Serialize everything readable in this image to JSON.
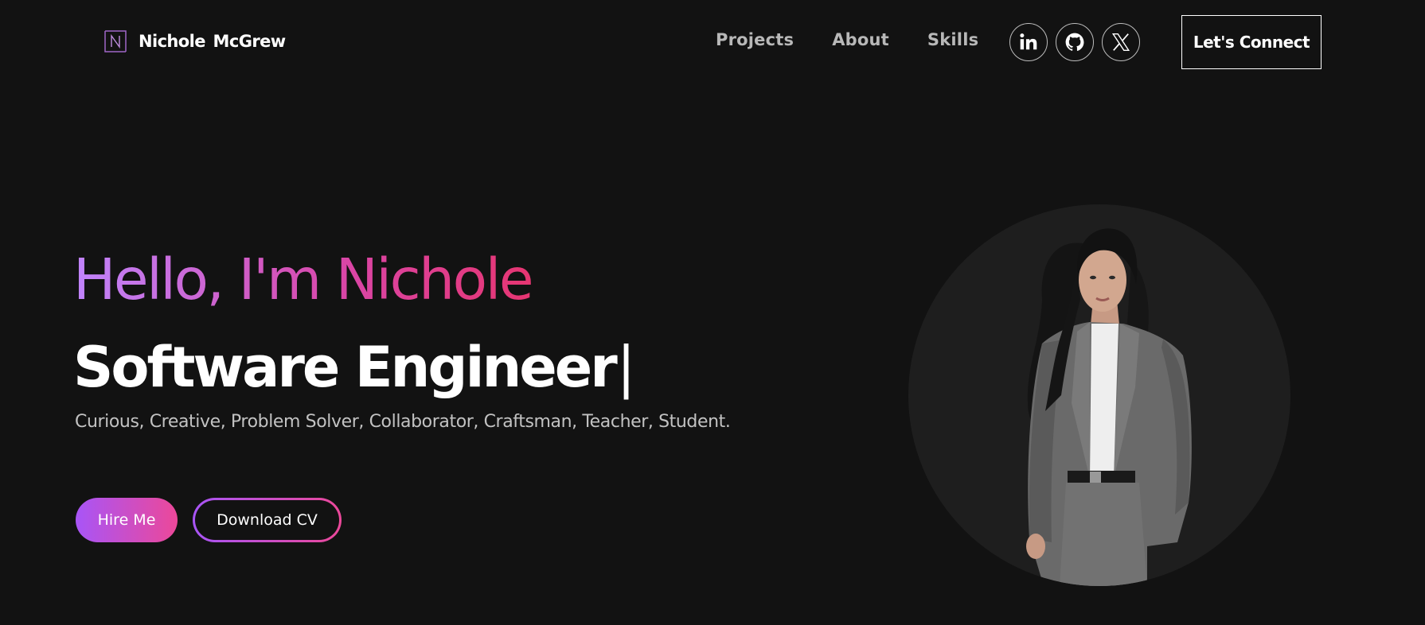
{
  "brand": {
    "logo_icon": "n-monogram-icon",
    "name": "Nichole  McGrew"
  },
  "nav": {
    "links": [
      "Projects",
      "About",
      "Skills"
    ]
  },
  "socials": {
    "icons": [
      "linkedin-icon",
      "github-icon",
      "x-icon"
    ]
  },
  "cta": {
    "connect_label": "Let's Connect"
  },
  "hero": {
    "greeting": "Hello, I'm Nichole",
    "role": "Software Engineer",
    "caret": "|",
    "tagline": "Curious, Creative, Problem Solver, Collaborator, Craftsman, Teacher, Student.",
    "hire_label": "Hire Me",
    "cv_label": "Download CV",
    "portrait_icon": "profile-photo"
  },
  "colors": {
    "background": "#121212",
    "gradient_start": "#a855f7",
    "gradient_end": "#ec4899",
    "nav_text": "#b8b8b8",
    "tagline_text": "#c2c2c2",
    "portrait_circle": "#1e1e1e"
  }
}
